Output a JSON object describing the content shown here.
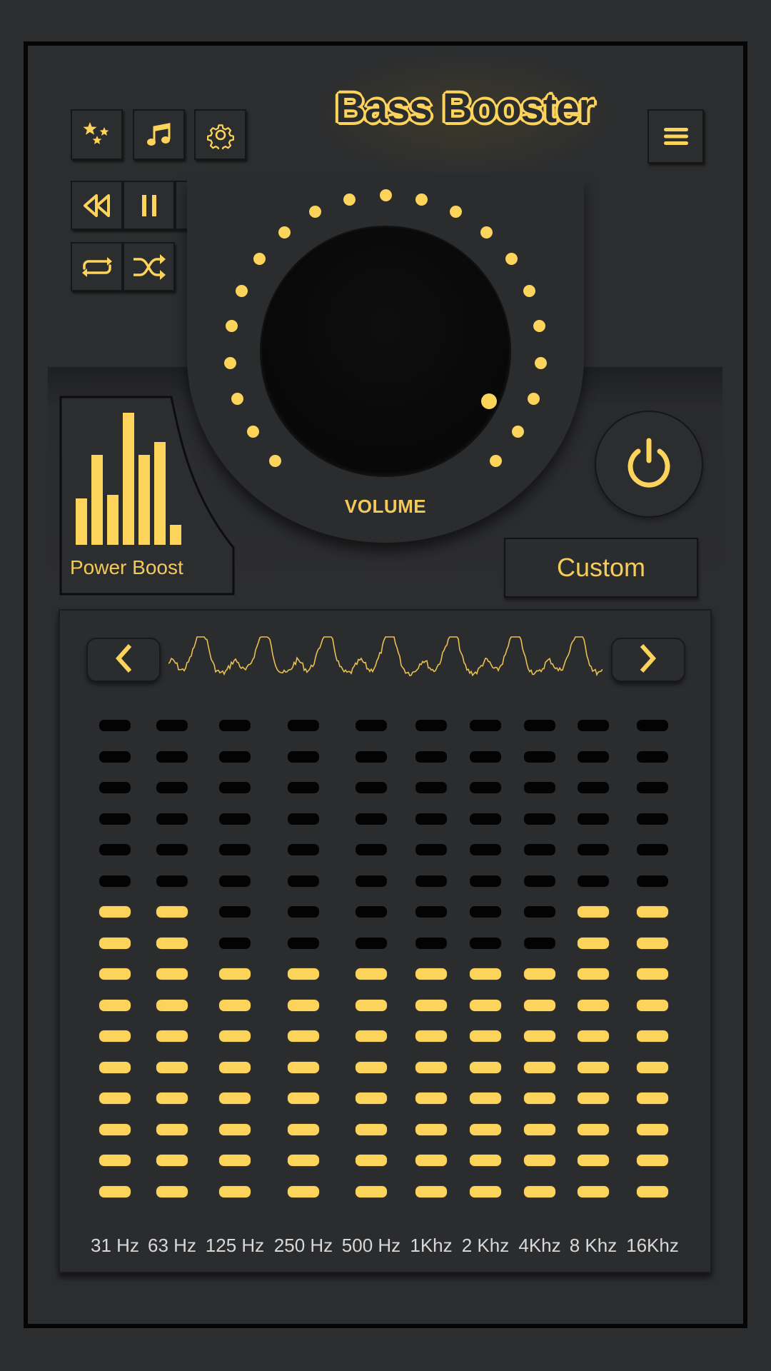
{
  "app": {
    "title": "Bass Booster"
  },
  "toolbar": {
    "buttons": [
      {
        "name": "themes",
        "icon": "stars-icon"
      },
      {
        "name": "music",
        "icon": "music-note-icon"
      },
      {
        "name": "settings",
        "icon": "gear-icon"
      }
    ],
    "menu_icon": "hamburger-menu-icon"
  },
  "playback": {
    "controls": [
      {
        "name": "previous",
        "icon": "rewind-icon"
      },
      {
        "name": "pause",
        "icon": "pause-icon"
      },
      {
        "name": "next",
        "icon": "fast-forward-icon"
      },
      {
        "name": "repeat",
        "icon": "repeat-icon"
      },
      {
        "name": "shuffle",
        "icon": "shuffle-icon"
      }
    ]
  },
  "volume": {
    "label": "VOLUME",
    "ticks": 24,
    "level_fraction": 0.93
  },
  "power_boost": {
    "label": "Power Boost",
    "icon": "bar-chart-icon",
    "bar_levels": [
      0.35,
      0.68,
      0.38,
      1.0,
      0.68,
      0.78,
      0.15
    ]
  },
  "power": {
    "icon": "power-icon",
    "state": "on"
  },
  "preset": {
    "label": "Custom"
  },
  "equalizer": {
    "prev_icon": "chevron-left-icon",
    "next_icon": "chevron-right-icon",
    "segments_per_band": 16,
    "bands": [
      {
        "label": "31 Hz",
        "level": 10
      },
      {
        "label": "63 Hz",
        "level": 10
      },
      {
        "label": "125 Hz",
        "level": 8
      },
      {
        "label": "250 Hz",
        "level": 8
      },
      {
        "label": "500 Hz",
        "level": 8
      },
      {
        "label": "1Khz",
        "level": 8
      },
      {
        "label": "2 Khz",
        "level": 8
      },
      {
        "label": "4Khz",
        "level": 8
      },
      {
        "label": "8 Khz",
        "level": 10
      },
      {
        "label": "16Khz",
        "level": 10
      }
    ]
  },
  "colors": {
    "accent": "#fcd35b",
    "background": "#2c2d2f",
    "segment_off": "#030303",
    "label_text": "#d8d8d8"
  }
}
